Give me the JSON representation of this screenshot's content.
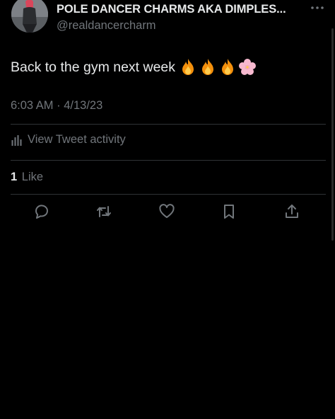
{
  "tweet": {
    "author": {
      "display_name": "POLE DANCER CHARMS AKA DIMPLES...",
      "handle": "@realdancercharm"
    },
    "text": "Back to the gym next week",
    "emojis": [
      "fire",
      "fire",
      "fire",
      "cherry-blossom"
    ],
    "timestamp": "6:03 AM · 4/13/23",
    "activity_label": "View Tweet activity",
    "likes": {
      "count": "1",
      "label": "Like"
    }
  },
  "colors": {
    "background": "#000000",
    "primary_text": "#e7e9ea",
    "secondary_text": "#71767b",
    "divider": "#2f3336"
  },
  "icons": {
    "more": "more-horizontal-icon",
    "activity": "bar-chart-icon",
    "reply": "reply-bubble-icon",
    "retweet": "retweet-icon",
    "like": "heart-icon",
    "bookmark": "bookmark-icon",
    "share": "share-upload-icon"
  }
}
